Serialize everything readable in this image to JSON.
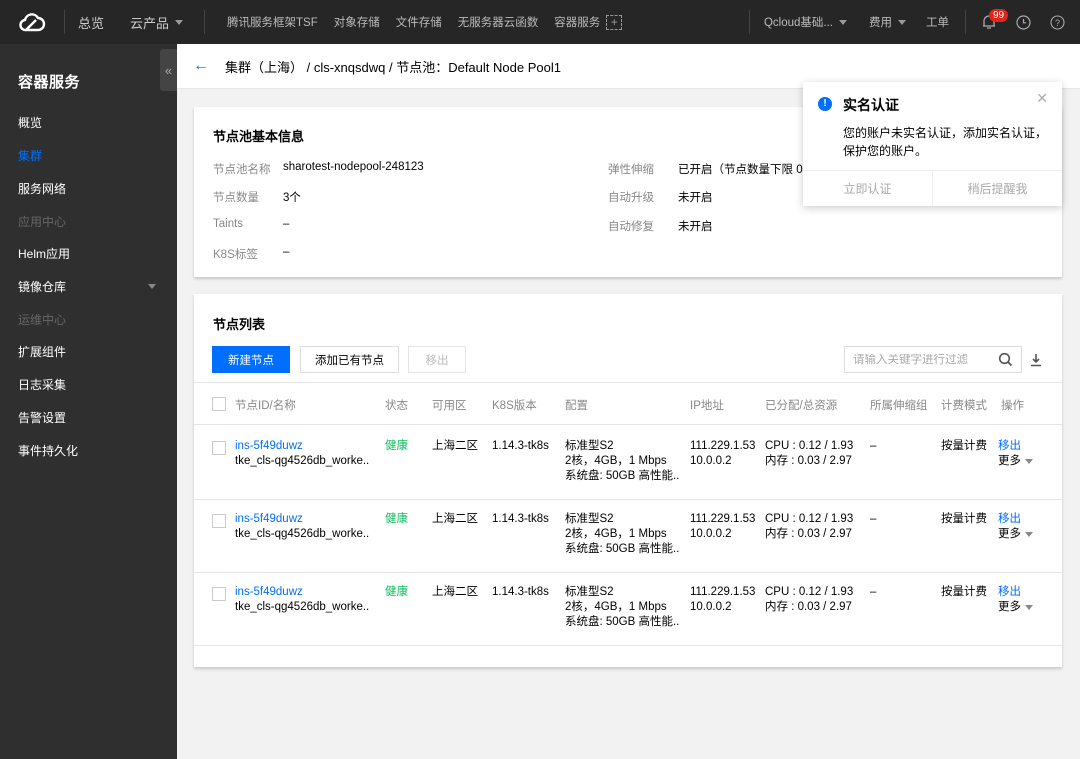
{
  "topbar": {
    "overview": "总览",
    "products": "云产品",
    "shortcuts": [
      "腾讯服务框架TSF",
      "对象存储",
      "文件存储",
      "无服务器云函数",
      "容器服务"
    ],
    "account": "Qcloud基础...",
    "billing": "费用",
    "tickets": "工单",
    "notification_count": "99"
  },
  "sidebar": {
    "title": "容器服务",
    "items": [
      {
        "label": "概览",
        "state": "normal"
      },
      {
        "label": "集群",
        "state": "active"
      },
      {
        "label": "服务网络",
        "state": "normal"
      },
      {
        "label": "应用中心",
        "state": "disabled"
      },
      {
        "label": "Helm应用",
        "state": "normal"
      },
      {
        "label": "镜像仓库",
        "state": "normal",
        "expandable": true
      },
      {
        "label": "运维中心",
        "state": "disabled"
      },
      {
        "label": "扩展组件",
        "state": "normal"
      },
      {
        "label": "日志采集",
        "state": "normal"
      },
      {
        "label": "告警设置",
        "state": "normal"
      },
      {
        "label": "事件持久化",
        "state": "normal"
      }
    ]
  },
  "breadcrumb": {
    "text": "集群（上海） / cls-xnqsdwq / 节点池：Default Node Pool1"
  },
  "basic_info": {
    "title": "节点池基本信息",
    "left": [
      {
        "key": "节点池名称",
        "value": "sharotest-nodepool-248123"
      },
      {
        "key": "节点数量",
        "value": "3个"
      },
      {
        "key": "Taints",
        "value": "–"
      },
      {
        "key": "K8S标签",
        "value": "–"
      }
    ],
    "right": [
      {
        "key": "弹性伸缩",
        "value": "已开启（节点数量下限 0 ~"
      },
      {
        "key": "自动升级",
        "value": "未开启"
      },
      {
        "key": "自动修复",
        "value": "未开启"
      }
    ]
  },
  "node_list": {
    "title": "节点列表",
    "buttons": {
      "create": "新建节点",
      "add_existing": "添加已有节点",
      "remove": "移出"
    },
    "search_placeholder": "请输入关键字进行过滤",
    "columns": [
      "节点ID/名称",
      "状态",
      "可用区",
      "K8S版本",
      "配置",
      "IP地址",
      "已分配/总资源",
      "所属伸缩组",
      "计费模式",
      "操作"
    ],
    "rows": [
      {
        "id": "ins-5f49duwz",
        "name": "tke_cls-qg4526db_worke..",
        "status": "健康",
        "zone": "上海二区",
        "k8s": "1.14.3-tk8s",
        "config": [
          "标准型S2",
          "2核，4GB，1 Mbps",
          "系统盘: 50GB 高性能.."
        ],
        "ip": [
          "111.229.1.53",
          "10.0.0.2"
        ],
        "resources": [
          "CPU : 0.12 / 1.93",
          "内存 : 0.03 / 2.97"
        ],
        "scaling_group": "–",
        "billing": "按量计费",
        "action": "移出",
        "more": "更多"
      },
      {
        "id": "ins-5f49duwz",
        "name": "tke_cls-qg4526db_worke..",
        "status": "健康",
        "zone": "上海二区",
        "k8s": "1.14.3-tk8s",
        "config": [
          "标准型S2",
          "2核，4GB，1 Mbps",
          "系统盘: 50GB 高性能.."
        ],
        "ip": [
          "111.229.1.53",
          "10.0.0.2"
        ],
        "resources": [
          "CPU : 0.12 / 1.93",
          "内存 : 0.03 / 2.97"
        ],
        "scaling_group": "–",
        "billing": "按量计费",
        "action": "移出",
        "more": "更多"
      },
      {
        "id": "ins-5f49duwz",
        "name": "tke_cls-qg4526db_worke..",
        "status": "健康",
        "zone": "上海二区",
        "k8s": "1.14.3-tk8s",
        "config": [
          "标准型S2",
          "2核，4GB，1 Mbps",
          "系统盘: 50GB 高性能.."
        ],
        "ip": [
          "111.229.1.53",
          "10.0.0.2"
        ],
        "resources": [
          "CPU : 0.12 / 1.93",
          "内存 : 0.03 / 2.97"
        ],
        "scaling_group": "–",
        "billing": "按量计费",
        "action": "移出",
        "more": "更多"
      }
    ]
  },
  "notice": {
    "title": "实名认证",
    "body": "您的账户未实名认证，添加实名认证，保护您的账户。",
    "confirm": "立即认证",
    "later": "稍后提醒我"
  },
  "colors": {
    "accent": "#006eff",
    "healthy": "#0abf5b",
    "badge": "#e1251b"
  }
}
